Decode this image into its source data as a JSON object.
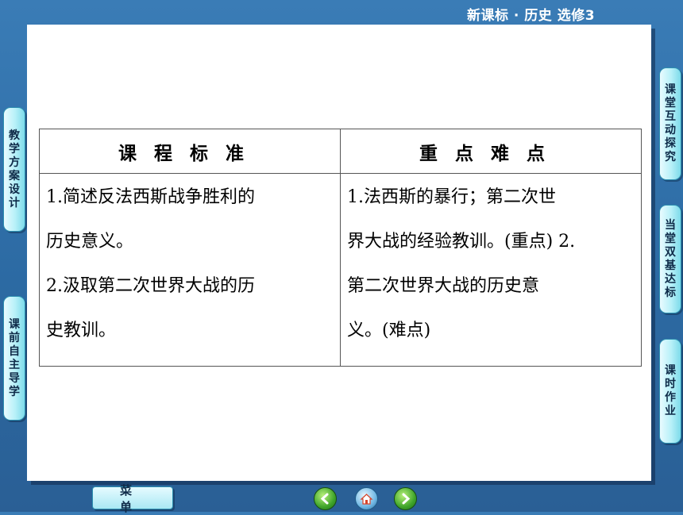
{
  "header": {
    "title": "新课标 · 历史    选修3"
  },
  "table": {
    "col1_header": "课程标准",
    "col2_header": "重点难点",
    "col1_lines": [
      "1.简述反法西斯战争胜利的",
      "历史意义。",
      "2.汲取第二次世界大战的历",
      "史教训。"
    ],
    "col2_lines": [
      "1.法西斯的暴行；第二次世",
      "界大战的经验教训。(重点) 2.",
      "第二次世界大战的历史意",
      "义。(难点)"
    ]
  },
  "left_tabs": [
    {
      "label": "教学方案设计"
    },
    {
      "label": "课前自主导学"
    }
  ],
  "right_tabs": [
    {
      "label": "课堂互动探究"
    },
    {
      "label": "当堂双基达标"
    },
    {
      "label": "课时作业"
    }
  ],
  "footer": {
    "menu_label": "菜单",
    "nav_icons": [
      "back-icon",
      "home-icon",
      "forward-icon"
    ]
  },
  "colors": {
    "background": "#2f6fa8",
    "tab_fill": "#b6f0f8",
    "nav_green": "#3fa52a"
  }
}
